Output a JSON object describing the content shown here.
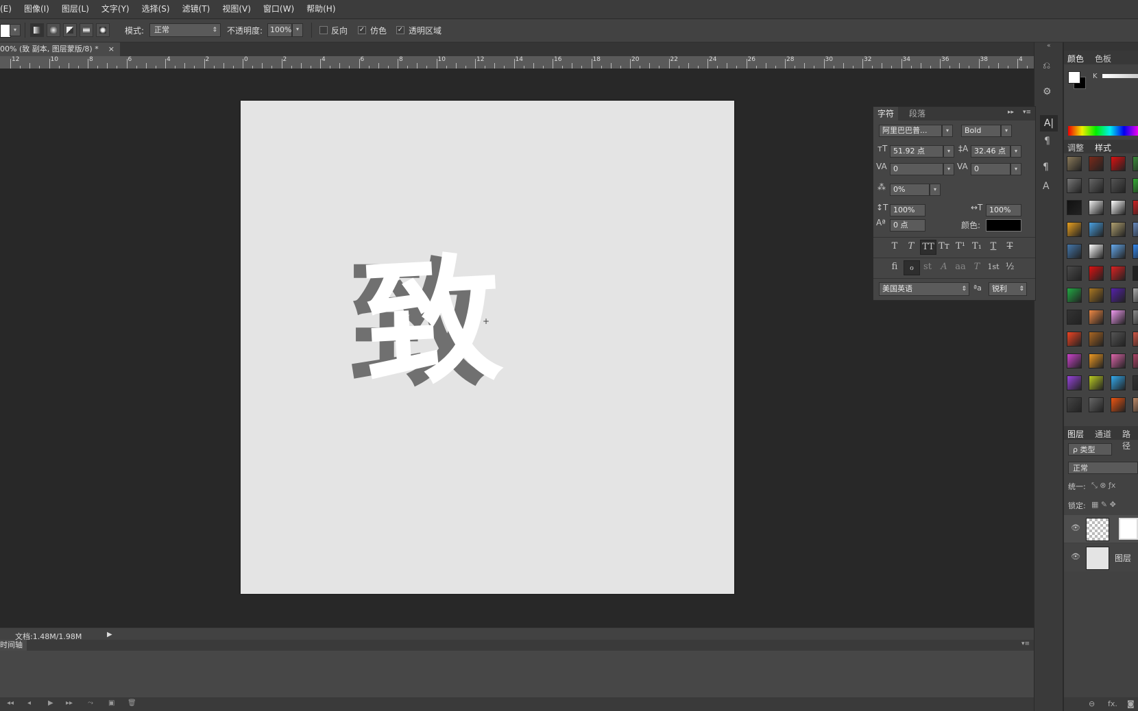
{
  "menu": [
    "(E)",
    "图像(I)",
    "图层(L)",
    "文字(Y)",
    "选择(S)",
    "滤镜(T)",
    "视图(V)",
    "窗口(W)",
    "帮助(H)"
  ],
  "options": {
    "mode_label": "模式:",
    "mode_value": "正常",
    "opacity_label": "不透明度:",
    "opacity_value": "100%",
    "reverse_label": "反向",
    "dither_label": "仿色",
    "transparency_label": "透明区域"
  },
  "document": {
    "tab_title": "00% (致 副本, 图层蒙版/8) *",
    "close_glyph": "×",
    "canvas_glyph": "致"
  },
  "ruler": {
    "labels": [
      "12",
      "10",
      "8",
      "6",
      "4",
      "2",
      "0",
      "2",
      "4",
      "6",
      "8",
      "10",
      "12",
      "14",
      "16",
      "18",
      "20",
      "22",
      "24",
      "26",
      "28",
      "30",
      "32",
      "34",
      "36",
      "38",
      "4"
    ]
  },
  "status": {
    "doc_size": "文档:1.48M/1.98M",
    "timeline_label": "时间轴"
  },
  "character_panel": {
    "tab_character": "字符",
    "tab_paragraph": "段落",
    "font_family": "阿里巴巴普...",
    "font_style": "Bold",
    "font_size": "51.92 点",
    "leading": "32.46 点",
    "kerning": "0",
    "tracking": "0",
    "tsume": "0%",
    "vscale": "100%",
    "hscale": "100%",
    "baseline": "0 点",
    "color_label": "颜色:",
    "text_color": "#000000",
    "type_buttons": [
      "T",
      "T",
      "TT",
      "Tт",
      "T¹",
      "T₁",
      "T",
      "T"
    ],
    "ot_buttons": [
      "fi",
      "ℴ",
      "st",
      "A",
      "aa",
      "T",
      "1st",
      "½"
    ],
    "language": "美国英语",
    "aa_label": "ªa",
    "antialias": "锐利"
  },
  "right_panel": {
    "color_tab": "颜色",
    "swatches_tab": "色板",
    "k_label": "K",
    "adjust_tab": "调整",
    "styles_tab": "样式",
    "layers_tab": "图层",
    "channels_tab": "通道",
    "paths_tab": "路径",
    "filter_kind": "ρ 类型",
    "blend_mode": "正常",
    "unify_label": "统一:",
    "lock_label": "锁定:",
    "layer2_name": "图层"
  },
  "style_colors": [
    [
      "#8a7a5a",
      "#7a2a1a",
      "#dd1111",
      "#3a8a3a"
    ],
    [
      "#777777",
      "#666666",
      "#555555",
      "#33aa33"
    ],
    [
      "#111111",
      "#eeeeee",
      "#ffffff",
      "#cc2222"
    ],
    [
      "#e8a020",
      "#4aa0e0",
      "#b0a070",
      "#6688bb"
    ],
    [
      "#4477aa",
      "#ffffff",
      "#66aaee",
      "#3388ee"
    ],
    [
      "#4a4a4a",
      "#dd1111",
      "#dd2222",
      "#222222"
    ],
    [
      "#22aa44",
      "#aa7722",
      "#5522aa",
      "#aaaaaa"
    ],
    [
      "#333333",
      "#ee8844",
      "#ee99ee",
      "#888888"
    ],
    [
      "#ee4422",
      "#aa6622",
      "#555555",
      "#cc5544"
    ],
    [
      "#cc44cc",
      "#ee9922",
      "#dd66aa",
      "#aa4466"
    ],
    [
      "#9944dd",
      "#bbcc22",
      "#33aaee",
      "#333333"
    ],
    [
      "#444444",
      "#666666",
      "#ee5511",
      "#bb8866"
    ]
  ]
}
